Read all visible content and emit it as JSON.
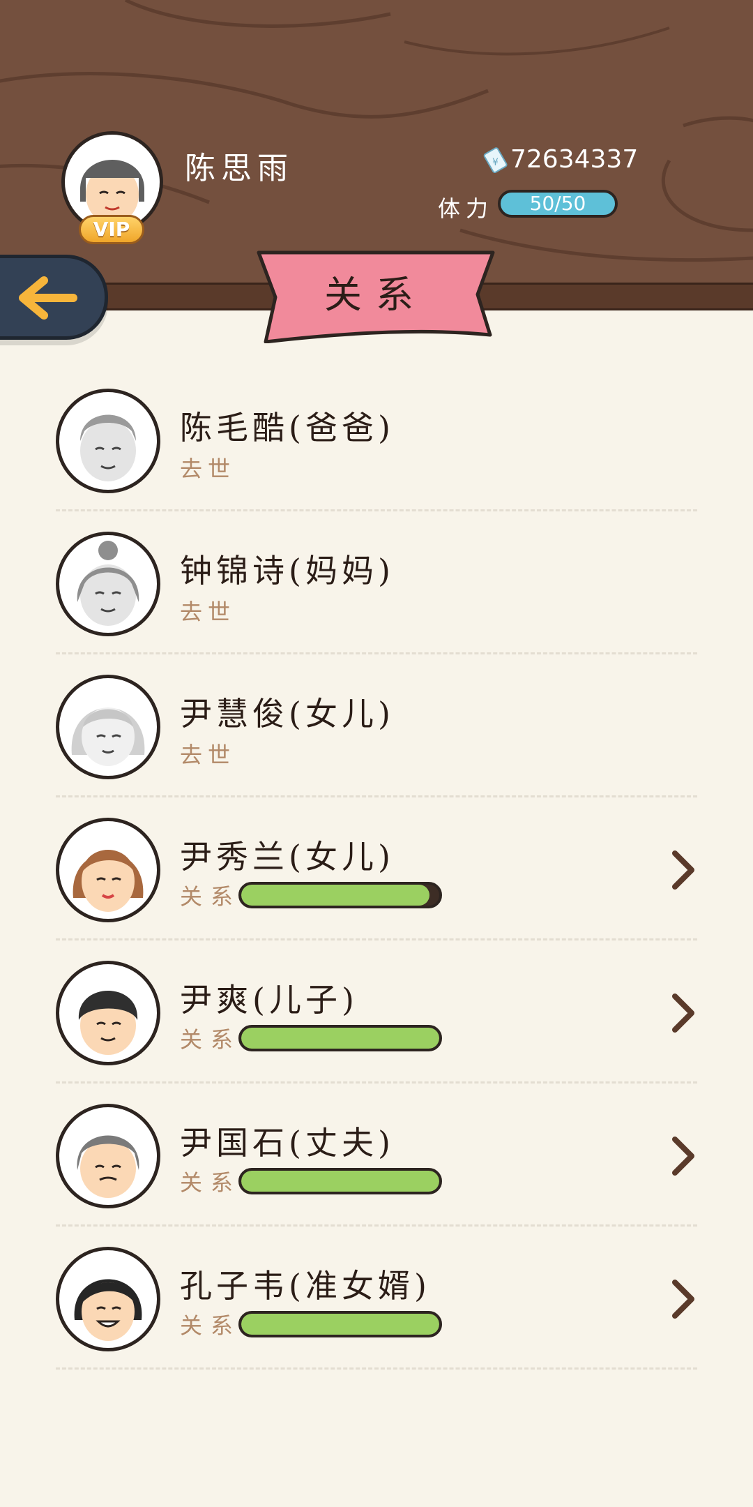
{
  "player": {
    "name": "陈思雨",
    "vip": "VIP",
    "money": "72634337",
    "stamina_label": "体力",
    "stamina": "50/50"
  },
  "page_title": "关系",
  "relatives": [
    {
      "name": "陈毛酷(爸爸)",
      "status": "去世",
      "deceased": true
    },
    {
      "name": "钟锦诗(妈妈)",
      "status": "去世",
      "deceased": true
    },
    {
      "name": "尹慧俊(女儿)",
      "status": "去世",
      "deceased": true
    },
    {
      "name": "尹秀兰(女儿)",
      "relation_label": "关系",
      "relation_level": 0.95,
      "deceased": false
    },
    {
      "name": "尹爽(儿子)",
      "relation_label": "关系",
      "relation_level": 1.0,
      "deceased": false
    },
    {
      "name": "尹国石(丈夫)",
      "relation_label": "关系",
      "relation_level": 1.0,
      "deceased": false
    },
    {
      "name": "孔子韦(准女婿)",
      "relation_label": "关系",
      "relation_level": 1.0,
      "deceased": false
    }
  ],
  "colors": {
    "wood": "#74503e",
    "background": "#f8f4ea",
    "ribbon": "#f18a9b",
    "bar_fill": "#9bd061",
    "stamina": "#5ec0d8"
  }
}
